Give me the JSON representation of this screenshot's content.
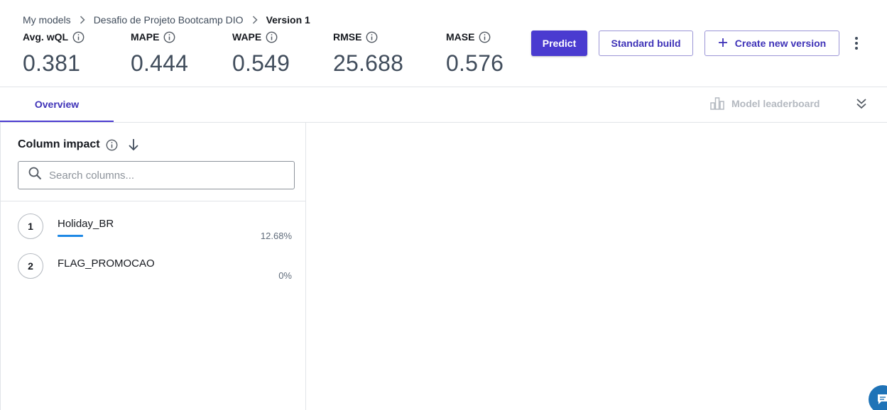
{
  "breadcrumb": {
    "items": [
      "My models",
      "Desafio de Projeto Bootcamp DIO"
    ],
    "current": "Version 1"
  },
  "metrics": [
    {
      "label": "Avg. wQL",
      "value": "0.381"
    },
    {
      "label": "MAPE",
      "value": "0.444"
    },
    {
      "label": "WAPE",
      "value": "0.549"
    },
    {
      "label": "RMSE",
      "value": "25.688"
    },
    {
      "label": "MASE",
      "value": "0.576"
    }
  ],
  "actions": {
    "predict": "Predict",
    "standard_build": "Standard build",
    "create_version": "Create new version"
  },
  "tabs": {
    "overview": "Overview",
    "leaderboard": "Model leaderboard"
  },
  "column_impact": {
    "title": "Column impact",
    "search_placeholder": "Search columns...",
    "items": [
      {
        "rank": "1",
        "name": "Holiday_BR",
        "percent": "12.68%",
        "fraction": 0.1268
      },
      {
        "rank": "2",
        "name": "FLAG_PROMOCAO",
        "percent": "0%",
        "fraction": 0
      }
    ]
  },
  "colors": {
    "primary": "#4a3bd0",
    "bar": "#1e88e5"
  }
}
